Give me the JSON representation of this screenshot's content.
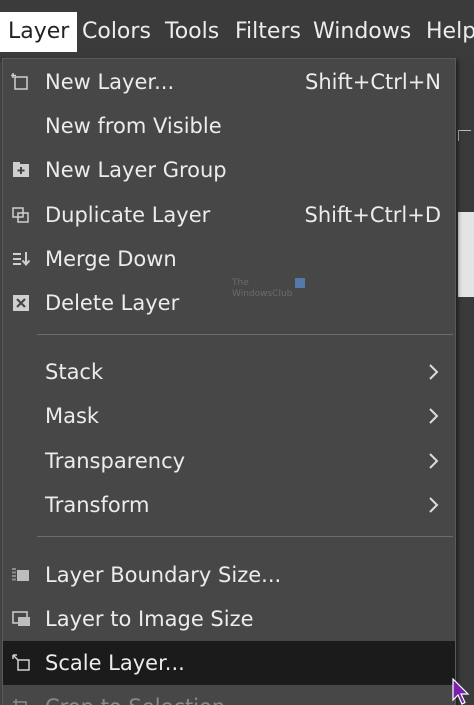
{
  "menubar": {
    "items": [
      {
        "label": "Layer"
      },
      {
        "label": "Colors"
      },
      {
        "label": "Tools"
      },
      {
        "label": "Filters"
      },
      {
        "label": "Windows"
      },
      {
        "label": "Help"
      }
    ]
  },
  "menu": {
    "items": [
      {
        "label": "New Layer...",
        "shortcut": "Shift+Ctrl+N",
        "icon": "new-layer-icon"
      },
      {
        "label": "New from Visible",
        "shortcut": "",
        "icon": ""
      },
      {
        "label": "New Layer Group",
        "shortcut": "",
        "icon": "layer-group-icon"
      },
      {
        "label": "Duplicate Layer",
        "shortcut": "Shift+Ctrl+D",
        "icon": "duplicate-icon"
      },
      {
        "label": "Merge Down",
        "shortcut": "",
        "icon": "merge-down-icon"
      },
      {
        "label": "Delete Layer",
        "shortcut": "",
        "icon": "delete-icon"
      },
      {
        "label": "Stack",
        "submenu": true
      },
      {
        "label": "Mask",
        "submenu": true
      },
      {
        "label": "Transparency",
        "submenu": true
      },
      {
        "label": "Transform",
        "submenu": true
      },
      {
        "label": "Layer Boundary Size...",
        "icon": "layer-boundary-icon"
      },
      {
        "label": "Layer to Image Size",
        "icon": "layer-to-image-icon"
      },
      {
        "label": "Scale Layer...",
        "icon": "scale-layer-icon",
        "highlighted": true
      },
      {
        "label": "Crop to Selection",
        "icon": "crop-icon",
        "disabled": true
      }
    ]
  },
  "watermark": {
    "line1": "The",
    "line2": "WindowsClub"
  },
  "colors": {
    "menu_bg": "#474747",
    "menubar_bg": "#3b3b3b",
    "highlight": "#1b1b1b",
    "text": "#ececec",
    "active_menubar_bg": "#ffffff"
  }
}
